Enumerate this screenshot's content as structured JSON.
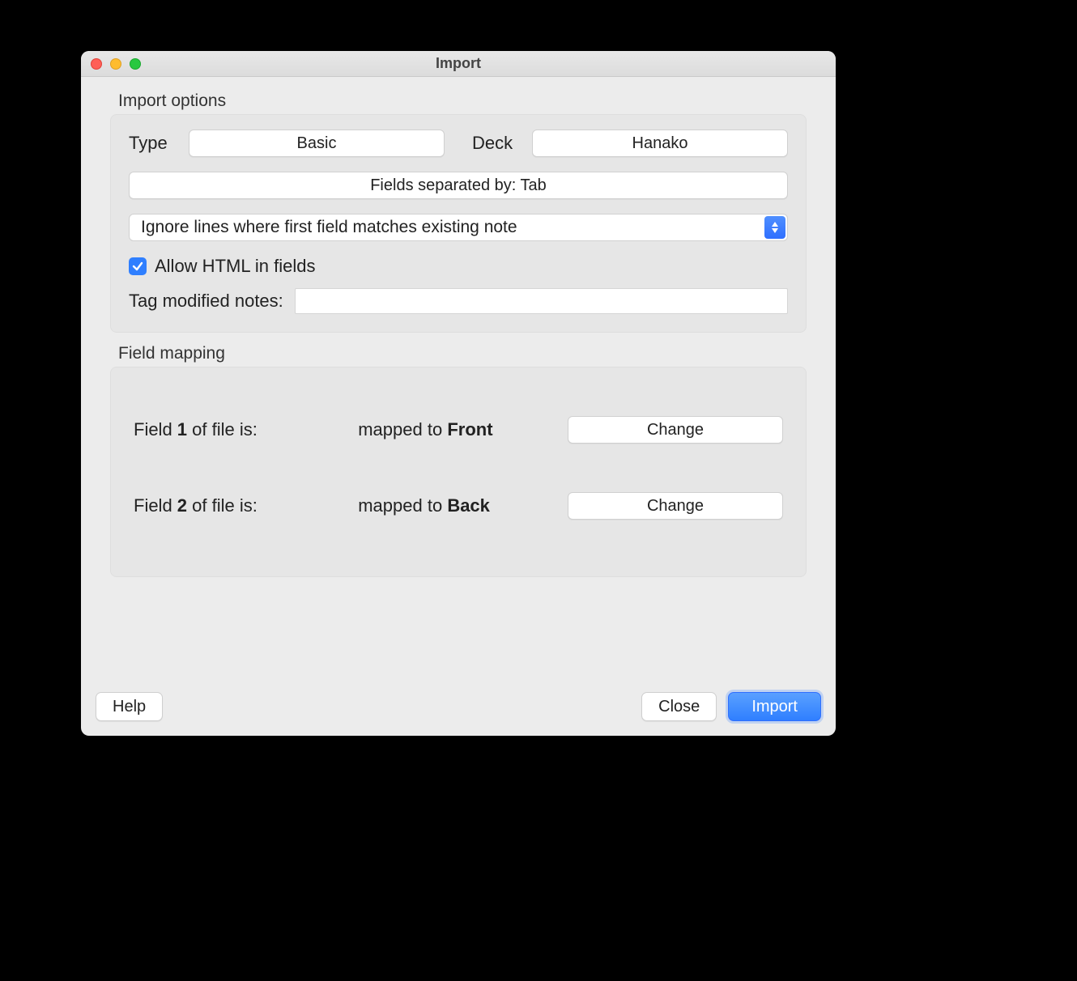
{
  "window": {
    "title": "Import"
  },
  "groups": {
    "import_options_label": "Import options",
    "field_mapping_label": "Field mapping"
  },
  "type_label": "Type",
  "type_value": "Basic",
  "deck_label": "Deck",
  "deck_value": "Hanako",
  "separator_button": "Fields separated by: Tab",
  "duplicate_mode": "Ignore lines where first field matches existing note",
  "allow_html_label": "Allow HTML in fields",
  "allow_html_checked": true,
  "tag_modified_label": "Tag modified notes:",
  "tag_modified_value": "",
  "mapping": [
    {
      "field_prefix": "Field ",
      "field_num": "1",
      "field_suffix": " of file is:",
      "mapped_prefix": "mapped to ",
      "mapped_to": "Front",
      "change_label": "Change"
    },
    {
      "field_prefix": "Field ",
      "field_num": "2",
      "field_suffix": " of file is:",
      "mapped_prefix": "mapped to ",
      "mapped_to": "Back",
      "change_label": "Change"
    }
  ],
  "footer": {
    "help": "Help",
    "close": "Close",
    "import": "Import"
  }
}
